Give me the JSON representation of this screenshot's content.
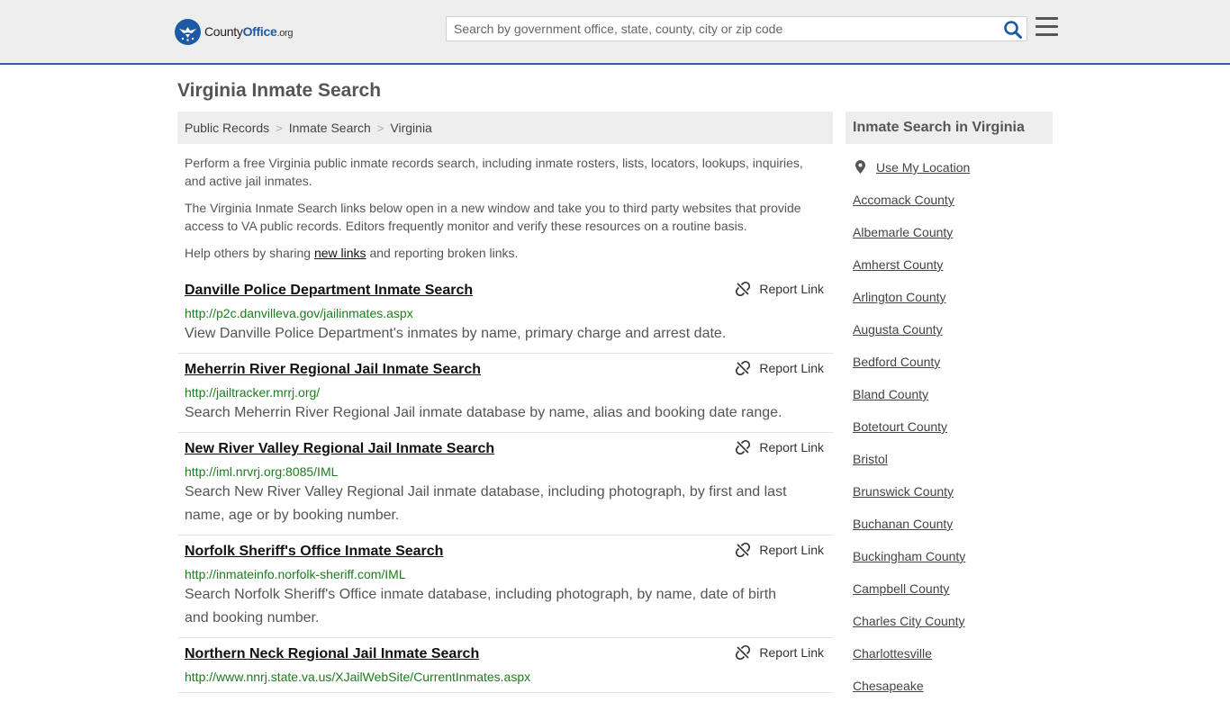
{
  "header": {
    "logo_name": "County",
    "logo_office": "Office",
    "logo_org": ".org",
    "search_placeholder": "Search by government office, state, county, city or zip code",
    "search_icon": "search-icon",
    "menu_icon": "hamburger-menu-icon",
    "brand_color": "#1c5aa6"
  },
  "page": {
    "title": "Virginia Inmate Search"
  },
  "breadcrumb": [
    {
      "label": "Public Records"
    },
    {
      "label": "Inmate Search"
    },
    {
      "label": "Virginia"
    }
  ],
  "intro": {
    "p1": "Perform a free Virginia public inmate records search, including inmate rosters, lists, locators, lookups, inquiries, and active jail inmates.",
    "p2": "The Virginia Inmate Search links below open in a new window and take you to third party websites that provide access to VA public records. Editors frequently monitor and verify these resources on a routine basis.",
    "p3_pre": "Help others by sharing ",
    "p3_link": "new links",
    "p3_post": " and reporting broken links."
  },
  "report_label": "Report Link",
  "results": [
    {
      "title": "Danville Police Department Inmate Search",
      "url": "http://p2c.danvilleva.gov/jailinmates.aspx",
      "desc": "View Danville Police Department's inmates by name, primary charge and arrest date."
    },
    {
      "title": "Meherrin River Regional Jail Inmate Search",
      "url": "http://jailtracker.mrrj.org/",
      "desc": "Search Meherrin River Regional Jail inmate database by name, alias and booking date range."
    },
    {
      "title": "New River Valley Regional Jail Inmate Search",
      "url": "http://iml.nrvrj.org:8085/IML",
      "desc": "Search New River Valley Regional Jail inmate database, including photograph, by first and last name, age or by booking number."
    },
    {
      "title": "Norfolk Sheriff's Office Inmate Search",
      "url": "http://inmateinfo.norfolk-sheriff.com/IML",
      "desc": "Search Norfolk Sheriff's Office inmate database, including photograph, by name, date of birth and booking number."
    },
    {
      "title": "Northern Neck Regional Jail Inmate Search",
      "url": "http://www.nnrj.state.va.us/XJailWebSite/CurrentInmates.aspx",
      "desc": ""
    }
  ],
  "sidebar": {
    "heading": "Inmate Search in Virginia",
    "use_location": "Use My Location",
    "items": [
      "Accomack County",
      "Albemarle County",
      "Amherst County",
      "Arlington County",
      "Augusta County",
      "Bedford County",
      "Bland County",
      "Botetourt County",
      "Bristol",
      "Brunswick County",
      "Buchanan County",
      "Buckingham County",
      "Campbell County",
      "Charles City County",
      "Charlottesville",
      "Chesapeake"
    ]
  }
}
